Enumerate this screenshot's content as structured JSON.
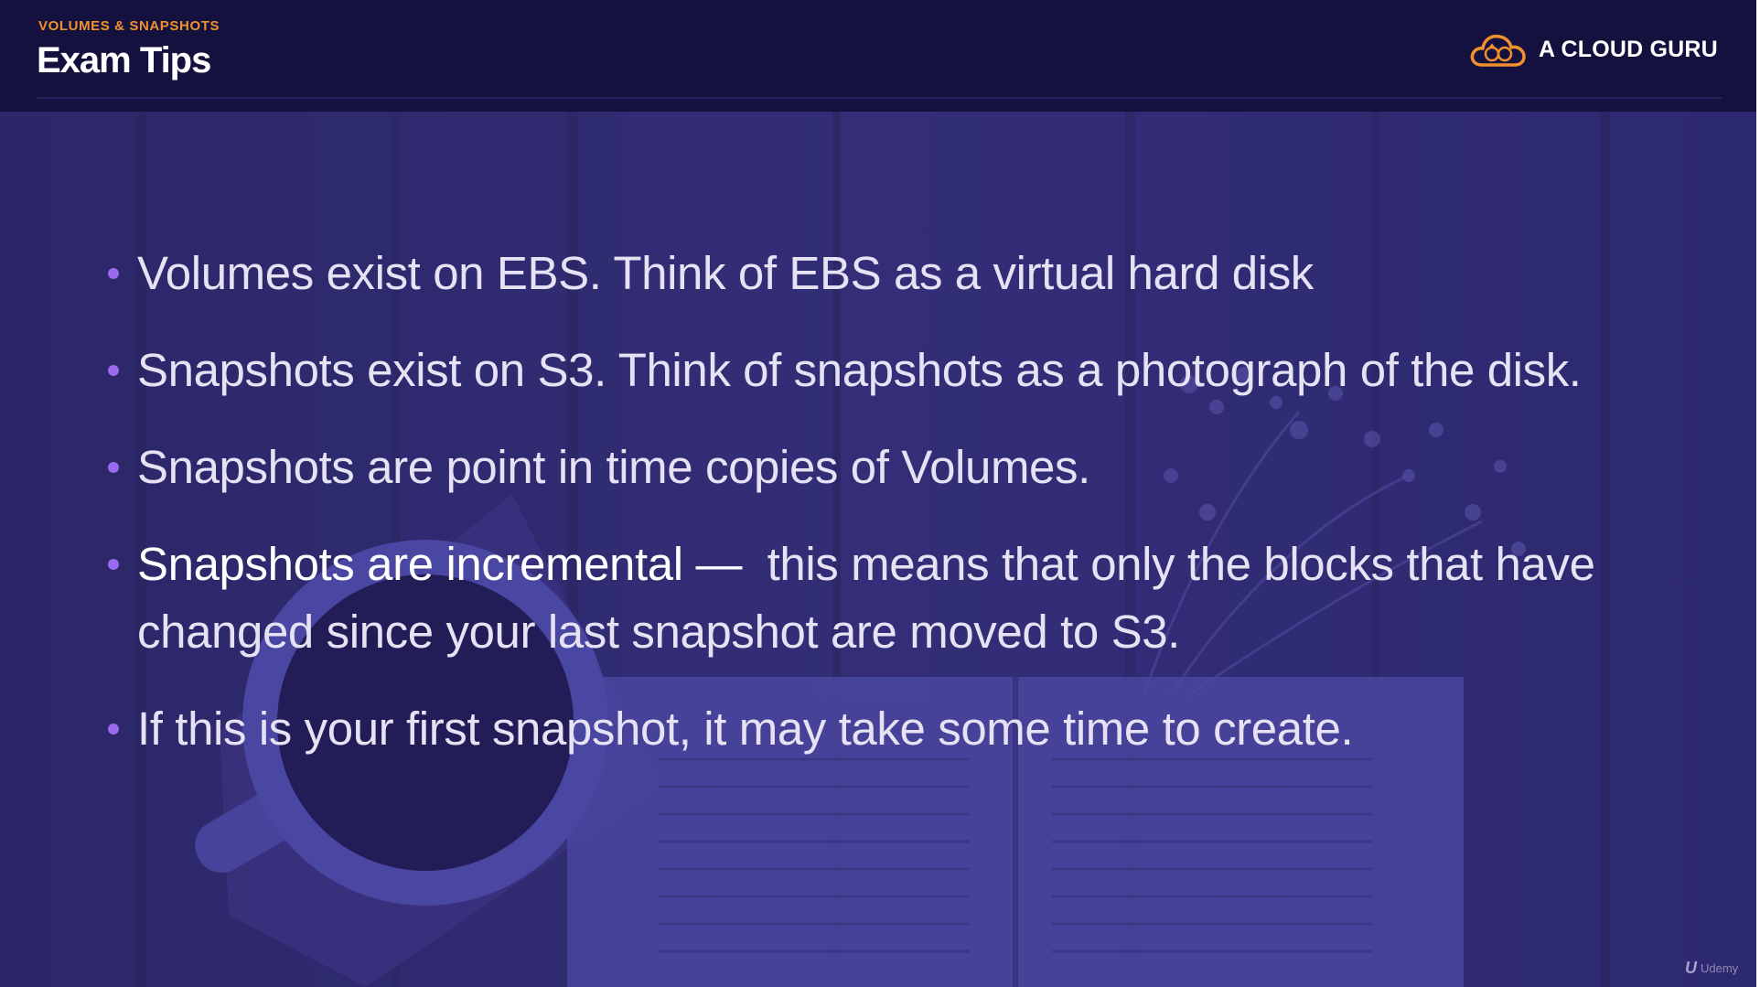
{
  "header": {
    "kicker": "VOLUMES & SNAPSHOTS",
    "title": "Exam Tips",
    "brand": {
      "name": "A CLOUD GURU",
      "logo_icon": "cloud-logo-icon",
      "accent_color": "#f0912d"
    }
  },
  "bullets": [
    {
      "lead": "",
      "text": "Volumes exist on EBS. Think of EBS as a virtual hard disk"
    },
    {
      "lead": "",
      "text": "Snapshots exist on S3. Think of snapshots as a photograph of the disk."
    },
    {
      "lead": "",
      "text": "Snapshots are point in time copies of Volumes."
    },
    {
      "lead": "Snapshots are incremental —",
      "text": "  this means that only the blocks that have changed since your last snapshot are moved to S3."
    },
    {
      "lead": "",
      "text": "If this is your first snapshot, it may take some time to create."
    }
  ],
  "watermark": {
    "icon": "udemy-logo-icon",
    "mark": "U",
    "text": "Udemy"
  },
  "colors": {
    "header_bg": "#15113f",
    "slide_bg": "#2e2a6c",
    "bullet_dot": "#9a6bf0",
    "bullet_text": "#e6e2f4"
  }
}
